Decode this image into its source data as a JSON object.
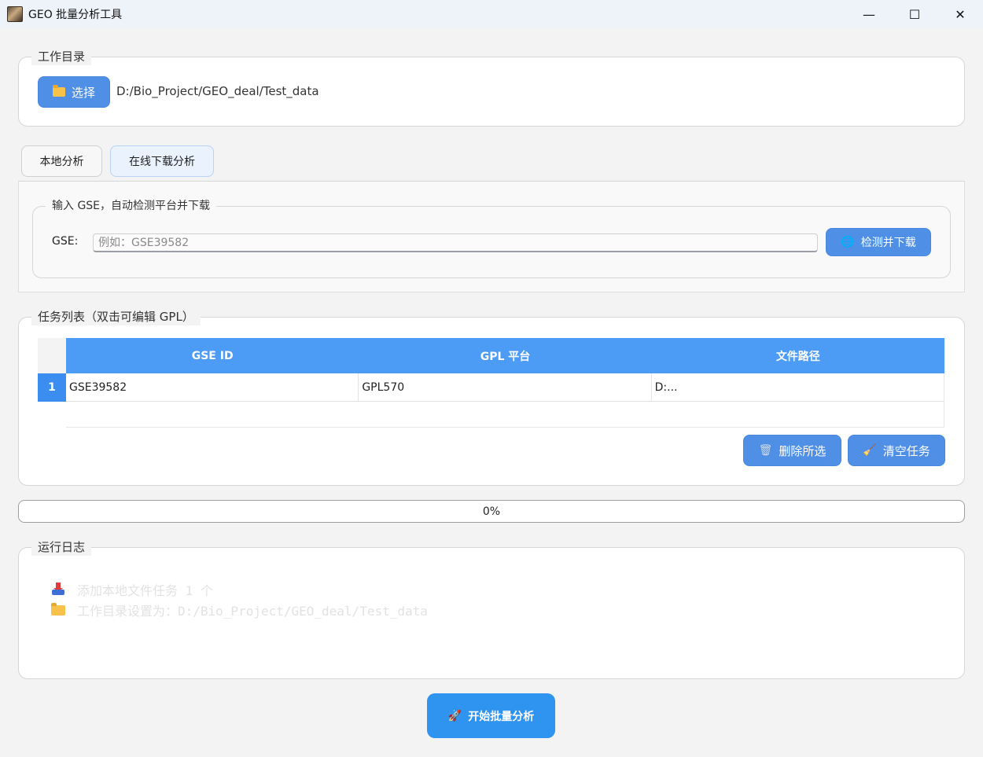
{
  "window": {
    "title": "GEO 批量分析工具",
    "minimize_glyph": "—",
    "maximize_glyph": "☐",
    "close_glyph": "✕"
  },
  "workdir": {
    "group_title": "工作目录",
    "select_label": "选择",
    "path": "D:/Bio_Project/GEO_deal/Test_data"
  },
  "tabs": [
    {
      "label": "本地分析",
      "active": false
    },
    {
      "label": "在线下载分析",
      "active": true
    }
  ],
  "online": {
    "group_title": "输入 GSE，自动检测平台并下载",
    "gse_label": "GSE:",
    "gse_placeholder": "例如：GSE39582",
    "gse_value": "",
    "detect_label": "检测并下载"
  },
  "tasks": {
    "group_title": "任务列表（双击可编辑 GPL）",
    "columns": [
      "GSE ID",
      "GPL 平台",
      "文件路径"
    ],
    "rows": [
      {
        "num": "1",
        "gse": "GSE39582",
        "gpl": "GPL570",
        "path": "D:..."
      }
    ],
    "delete_label": "删除所选",
    "clear_label": "清空任务"
  },
  "progress": {
    "value": 0,
    "text": "0%"
  },
  "log": {
    "group_title": "运行日志",
    "lines": [
      {
        "icon": "inbox-icon",
        "text": "添加本地文件任务 1 个"
      },
      {
        "icon": "folder-icon",
        "text": "工作目录设置为：D:/Bio_Project/GEO_deal/Test_data"
      }
    ]
  },
  "start_button": {
    "label": "开始批量分析"
  },
  "colors": {
    "accent": "#4c9bf5",
    "button": "#4f8fe6",
    "start_button": "#2f93f0"
  }
}
